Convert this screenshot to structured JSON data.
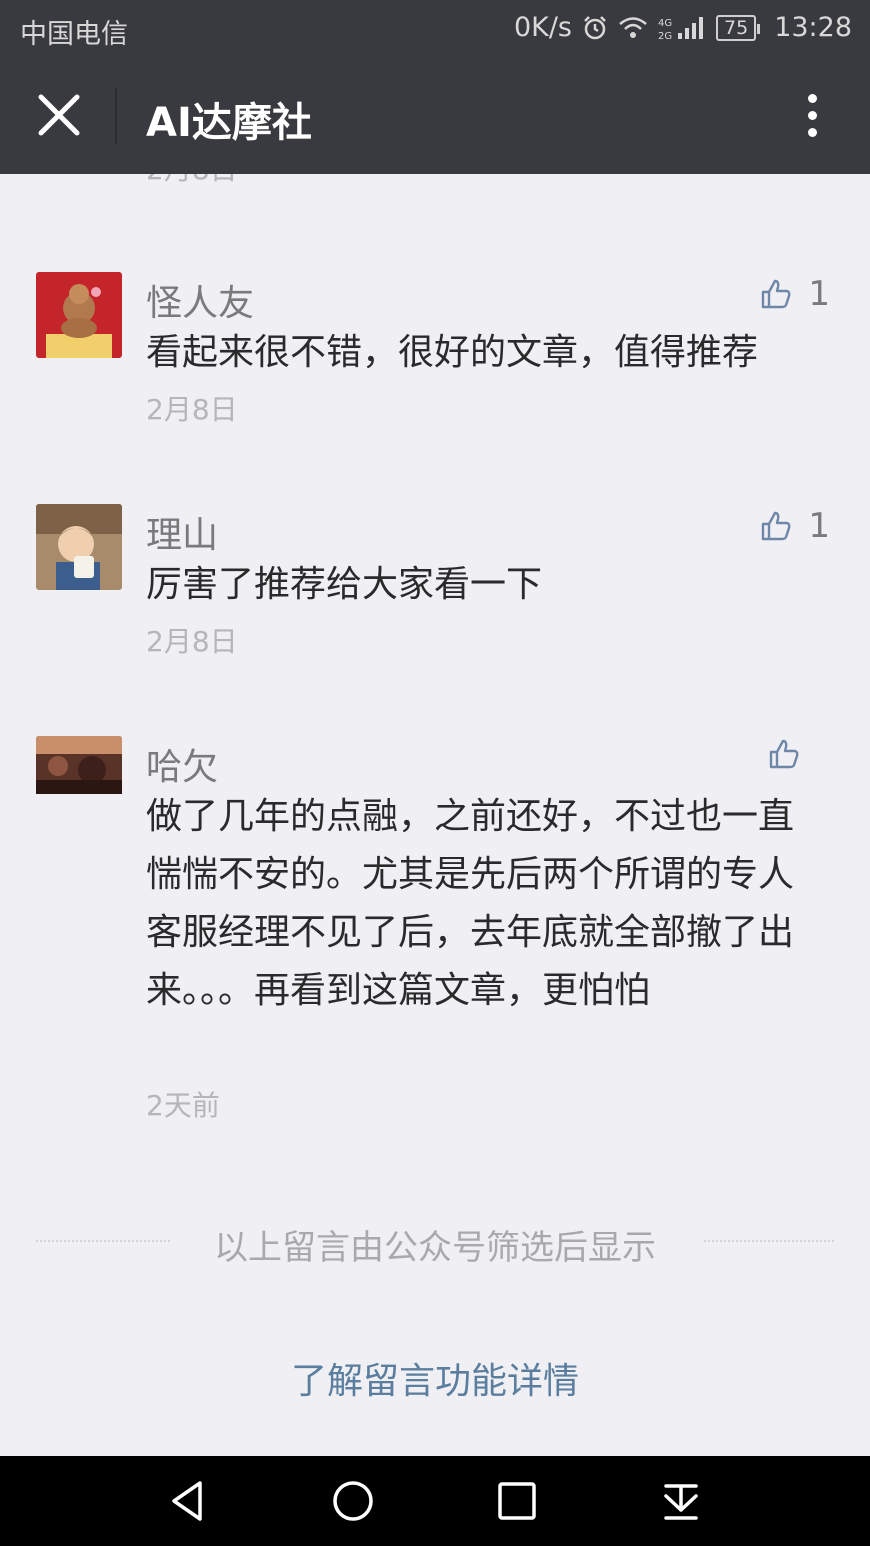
{
  "status_bar": {
    "carrier": "中国电信",
    "speed": "0K/s",
    "network": "4G 2G",
    "battery": "75",
    "time": "13:28"
  },
  "nav": {
    "title": "AI达摩社",
    "close_icon": "close-icon",
    "more_icon": "more-vertical-icon"
  },
  "cut_off_date": "2月8日",
  "comments": [
    {
      "nickname": "怪人友",
      "text": "看起来很不错，很好的文章，值得推荐",
      "date": "2月8日",
      "likes": "1"
    },
    {
      "nickname": "理山",
      "text": "厉害了推荐给大家看一下",
      "date": "2月8日",
      "likes": "1"
    },
    {
      "nickname": "哈欠",
      "text": "做了几年的点融，之前还好，不过也一直惴惴不安的。尤其是先后两个所谓的专人客服经理不见了后，去年底就全部撤了出来。。。再看到这篇文章，更怕怕",
      "date": "2天前",
      "likes": ""
    }
  ],
  "filter_note": "以上留言由公众号筛选后显示",
  "learn_more": "了解留言功能详情",
  "colors": {
    "bar_bg": "#393a3f",
    "page_bg": "#efeff4",
    "link": "#5b7e9f"
  }
}
